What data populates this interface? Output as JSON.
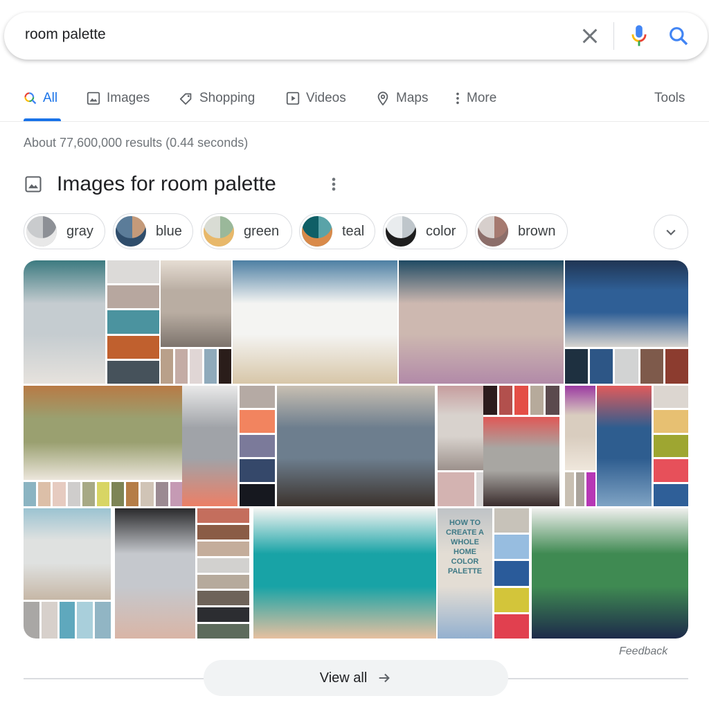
{
  "search": {
    "query": "room palette",
    "clear_icon": "close-icon",
    "voice_icon": "microphone-icon",
    "search_icon": "search-icon"
  },
  "tabs": [
    {
      "label": "All",
      "icon": "search-multicolor-icon",
      "active": true
    },
    {
      "label": "Images",
      "icon": "image-icon"
    },
    {
      "label": "Shopping",
      "icon": "tag-icon"
    },
    {
      "label": "Videos",
      "icon": "play-icon"
    },
    {
      "label": "Maps",
      "icon": "map-pin-icon"
    },
    {
      "label": "More",
      "icon": "more-vertical-icon"
    }
  ],
  "tools_label": "Tools",
  "result_stats": "About 77,600,000 results (0.44 seconds)",
  "images_section": {
    "title": "Images for room palette",
    "chips": [
      {
        "label": "gray",
        "colors": [
          "#c9cbcd",
          "#8d9096",
          "#e8e8e8"
        ]
      },
      {
        "label": "blue",
        "colors": [
          "#5b7c99",
          "#c49a7a",
          "#2f4d6b"
        ]
      },
      {
        "label": "green",
        "colors": [
          "#d9dcd4",
          "#9ab89a",
          "#e8b86a"
        ]
      },
      {
        "label": "teal",
        "colors": [
          "#0f5f66",
          "#5aa3a8",
          "#d98a4a"
        ]
      },
      {
        "label": "color",
        "colors": [
          "#e9ecee",
          "#bfc6cb",
          "#1e1e1e"
        ]
      },
      {
        "label": "brown",
        "colors": [
          "#d7cfcc",
          "#a67a70",
          "#8c6e6a"
        ]
      }
    ],
    "tiles": [
      {
        "scene": [
          "#c5ccd0",
          "#3c7a80",
          "#e6e2dd"
        ],
        "palette": [
          "#dcdad8",
          "#b7a79f",
          "#4b939f",
          "#c0602e",
          "#46525b"
        ]
      },
      {
        "scene": [
          "#b9ada2",
          "#e6ddd3",
          "#7d746d"
        ],
        "palette": [
          "#b9a08a",
          "#c4aca5",
          "#e0d6d5",
          "#8faabb",
          "#2a1d1a"
        ]
      },
      {
        "scene": [
          "#f4f4f2",
          "#4d7fa3",
          "#d7c6a8"
        ]
      },
      {
        "scene": [
          "#cdb8b0",
          "#1f4a63",
          "#b28aa8"
        ]
      },
      {
        "scene": [
          "#2f5f96",
          "#203553",
          "#d7d4cf"
        ],
        "palette": [
          "#1e3040",
          "#2d5686",
          "#d2d3d3",
          "#7e5a4b",
          "#8c3c2f"
        ]
      },
      {
        "scene": [
          "#8fa7ae",
          "#d9d8d4",
          "#6e6a67"
        ]
      },
      {
        "scene": [
          "#9aa070",
          "#b87a45",
          "#ece6dc"
        ],
        "palette": [
          "#8bb4c2",
          "#dcbfa8",
          "#e6cbc0",
          "#cfcdcc",
          "#a7a985",
          "#d8d564",
          "#7d8455",
          "#b57d47",
          "#d0c4b6",
          "#9b8a92",
          "#c59ab4"
        ]
      },
      {
        "scene": [
          "#a0a3a8",
          "#e9e9e9",
          "#ec7f66"
        ],
        "palette": [
          "#b5aaa4",
          "#f2845f",
          "#7b7a9a",
          "#35486a",
          "#16181f"
        ]
      },
      {
        "scene": [
          "#6d7e8e",
          "#c8bfb2",
          "#3c332d"
        ]
      },
      {
        "scene": [
          "#d8d2cd",
          "#c69d9e",
          "#9c918c"
        ],
        "palette": [
          "#d3b3b1",
          "#d8d6d6",
          "#7d7878"
        ]
      },
      {
        "scene": [
          "#a8a6a2",
          "#e05856",
          "#3a2c2c"
        ],
        "palette": [
          "#2c1c1d",
          "#b2504d",
          "#e44e46",
          "#b6aa9b",
          "#5b4a4e"
        ]
      },
      {
        "scene": [
          "#d9cdbf",
          "#9b3aa1",
          "#efe7dc"
        ],
        "palette": [
          "#c8bfb2",
          "#aaa39b",
          "#b637b5"
        ]
      },
      {
        "scene": [
          "#2e5d8f",
          "#e05b5b",
          "#7fa3c4"
        ],
        "palette": [
          "#dcd6d0",
          "#e7c072",
          "#9ea631",
          "#e7505a",
          "#2f5f98"
        ]
      },
      {
        "scene": [
          "#dfe1e0",
          "#9bc3d1",
          "#c6b7a6"
        ],
        "palette": [
          "#a9a7a5",
          "#d7d0cb",
          "#5fa8bd",
          "#a9cfdb",
          "#91b5c4"
        ]
      },
      {
        "scene": [
          "#c5c8cd",
          "#2a2a2c",
          "#d9b5a6"
        ],
        "palette": [
          "#c46e5d",
          "#8a5c46",
          "#c4ad9b",
          "#d2d1cf",
          "#b6aa9c",
          "#6e6359",
          "#2c2d31",
          "#5d6b5c"
        ]
      },
      {
        "scene": [
          "#18a3a6",
          "#f2f4f2",
          "#e7c0a0"
        ]
      },
      {
        "scene": [
          "#e3ddd4",
          "#bfc3c6",
          "#93b0cf"
        ],
        "palette": [
          "#c7c2b9",
          "#97bde0",
          "#2a5b9a",
          "#d3c53a",
          "#e1404f"
        ],
        "caption": "HOW TO CREATE A WHOLE HOME COLOR PALETTE"
      },
      {
        "scene": [
          "#3f8a52",
          "#efefed",
          "#1d2a4a"
        ]
      }
    ]
  },
  "feedback_label": "Feedback",
  "view_all_label": "View all",
  "colors": {
    "accent": "#1a73e8",
    "chip_border": "#dadce0",
    "secondary_text": "#70757a"
  }
}
